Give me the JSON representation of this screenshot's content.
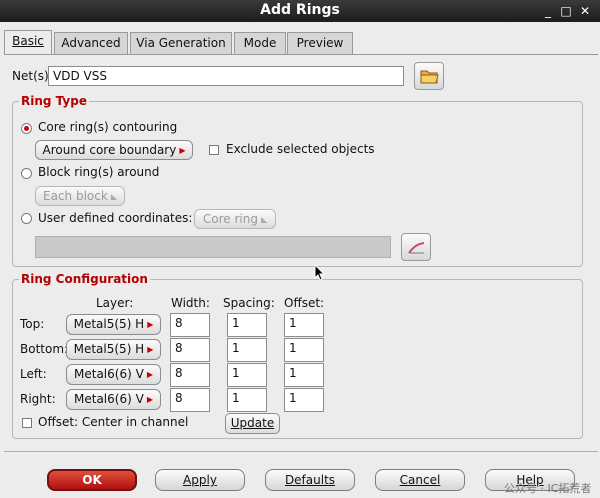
{
  "window": {
    "title": "Add Rings",
    "controls": [
      "_",
      "□",
      "✕"
    ]
  },
  "tabs": [
    {
      "label": "Basic",
      "active": true
    },
    {
      "label": "Advanced",
      "active": false
    },
    {
      "label": "Via Generation",
      "active": false
    },
    {
      "label": "Mode",
      "active": false
    },
    {
      "label": "Preview",
      "active": false
    }
  ],
  "nets": {
    "label": "Net(s):",
    "value": "VDD VSS",
    "browse_icon": "folder-icon"
  },
  "ring_type": {
    "title": "Ring Type",
    "core_ring_label": "Core ring(s) contouring",
    "core_ring_selected": true,
    "around_core_button": "Around core boundary",
    "exclude_label": "Exclude selected objects",
    "exclude_checked": false,
    "block_ring_label": "Block ring(s) around",
    "each_block_button": "Each block",
    "user_defined_label": "User defined coordinates:",
    "core_ring_button": "Core ring",
    "coords_value": "",
    "pick_icon": "pencil-icon"
  },
  "ring_config": {
    "title": "Ring Configuration",
    "col_layer": "Layer:",
    "col_width": "Width:",
    "col_spacing": "Spacing:",
    "col_offset": "Offset:",
    "rows": [
      {
        "side": "Top:",
        "layer": "Metal5(5) H",
        "width": "8",
        "spacing": "1",
        "offset": "1"
      },
      {
        "side": "Bottom:",
        "layer": "Metal5(5) H",
        "width": "8",
        "spacing": "1",
        "offset": "1"
      },
      {
        "side": "Left:",
        "layer": "Metal6(6) V",
        "width": "8",
        "spacing": "1",
        "offset": "1"
      },
      {
        "side": "Right:",
        "layer": "Metal6(6) V",
        "width": "8",
        "spacing": "1",
        "offset": "1"
      }
    ],
    "offset_center_label": "Offset: Center in channel",
    "offset_center_checked": false,
    "update_button": "Update"
  },
  "buttons": {
    "ok": "OK",
    "apply": "Apply",
    "defaults": "Defaults",
    "cancel": "Cancel",
    "help": "Help"
  },
  "watermark": "公众号 · IC拓荒者"
}
